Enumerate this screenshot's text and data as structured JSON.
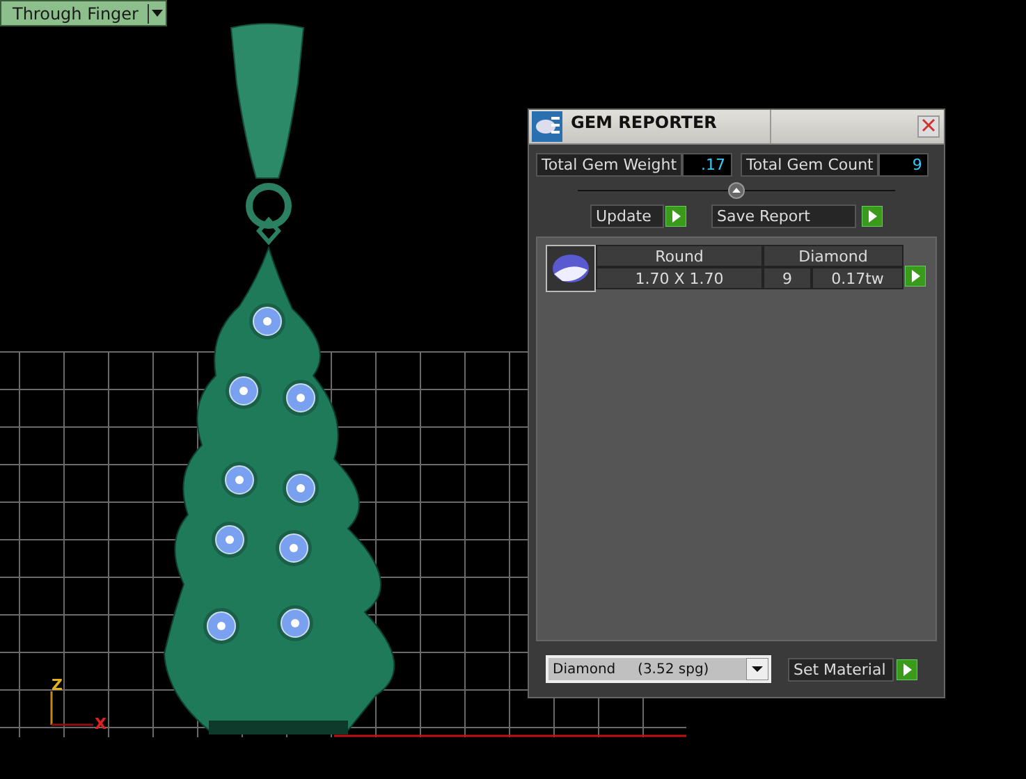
{
  "view_mode": {
    "label": "Through Finger"
  },
  "gem_reporter": {
    "title": "GEM REPORTER",
    "total_weight": {
      "label": "Total Gem Weight",
      "value": ".17"
    },
    "total_count": {
      "label": "Total Gem Count",
      "value": "9"
    },
    "buttons": [
      {
        "label": "Update"
      },
      {
        "label": "Save Report"
      }
    ],
    "gems": [
      {
        "shape": "Round",
        "material": "Diamond",
        "size": "1.70 X 1.70",
        "count": "9",
        "weight": "0.17tw"
      }
    ],
    "material_select": {
      "value": "Diamond     (3.52 spg)"
    },
    "set_material": {
      "label": "Set Material"
    }
  },
  "axes": {
    "vertical": "Z",
    "horizontal": "X"
  }
}
